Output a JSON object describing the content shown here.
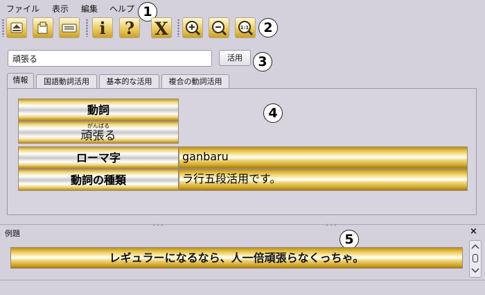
{
  "menu": [
    "ファイル",
    "表示",
    "編集",
    "ヘルプ"
  ],
  "toolbar": {
    "buttons": [
      {
        "name": "eject-icon",
        "glyph": "⏏"
      },
      {
        "name": "copy-icon",
        "glyph": "⎘"
      },
      {
        "name": "keyboard-icon",
        "glyph": "⌨"
      },
      {
        "name": "info-icon",
        "glyph": "i"
      },
      {
        "name": "help-icon",
        "glyph": "?"
      },
      {
        "name": "close-x-icon",
        "glyph": "X"
      },
      {
        "name": "zoom-in-icon",
        "glyph": "+"
      },
      {
        "name": "zoom-out-icon",
        "glyph": "−"
      },
      {
        "name": "zoom-reset-icon",
        "glyph": "1:1"
      }
    ]
  },
  "search": {
    "value": "頑張る",
    "button_label": "活用"
  },
  "tabs": [
    "情報",
    "国語動詞活用",
    "基本的な活用",
    "複合の動詞活用"
  ],
  "info": {
    "verb_header": "動詞",
    "furigana": "がんばる",
    "verb": "頑張る",
    "romaji_header": "ローマ字",
    "romaji": "ganbaru",
    "type_header": "動詞の種類",
    "type": "ラ行五段活用です。"
  },
  "examples": {
    "label": "例題",
    "sentence": "レギュラーになるなら、人一倍頑張らなくっちゃ。",
    "close_glyph": "×"
  },
  "callouts": [
    "1",
    "2",
    "3",
    "4",
    "5"
  ]
}
